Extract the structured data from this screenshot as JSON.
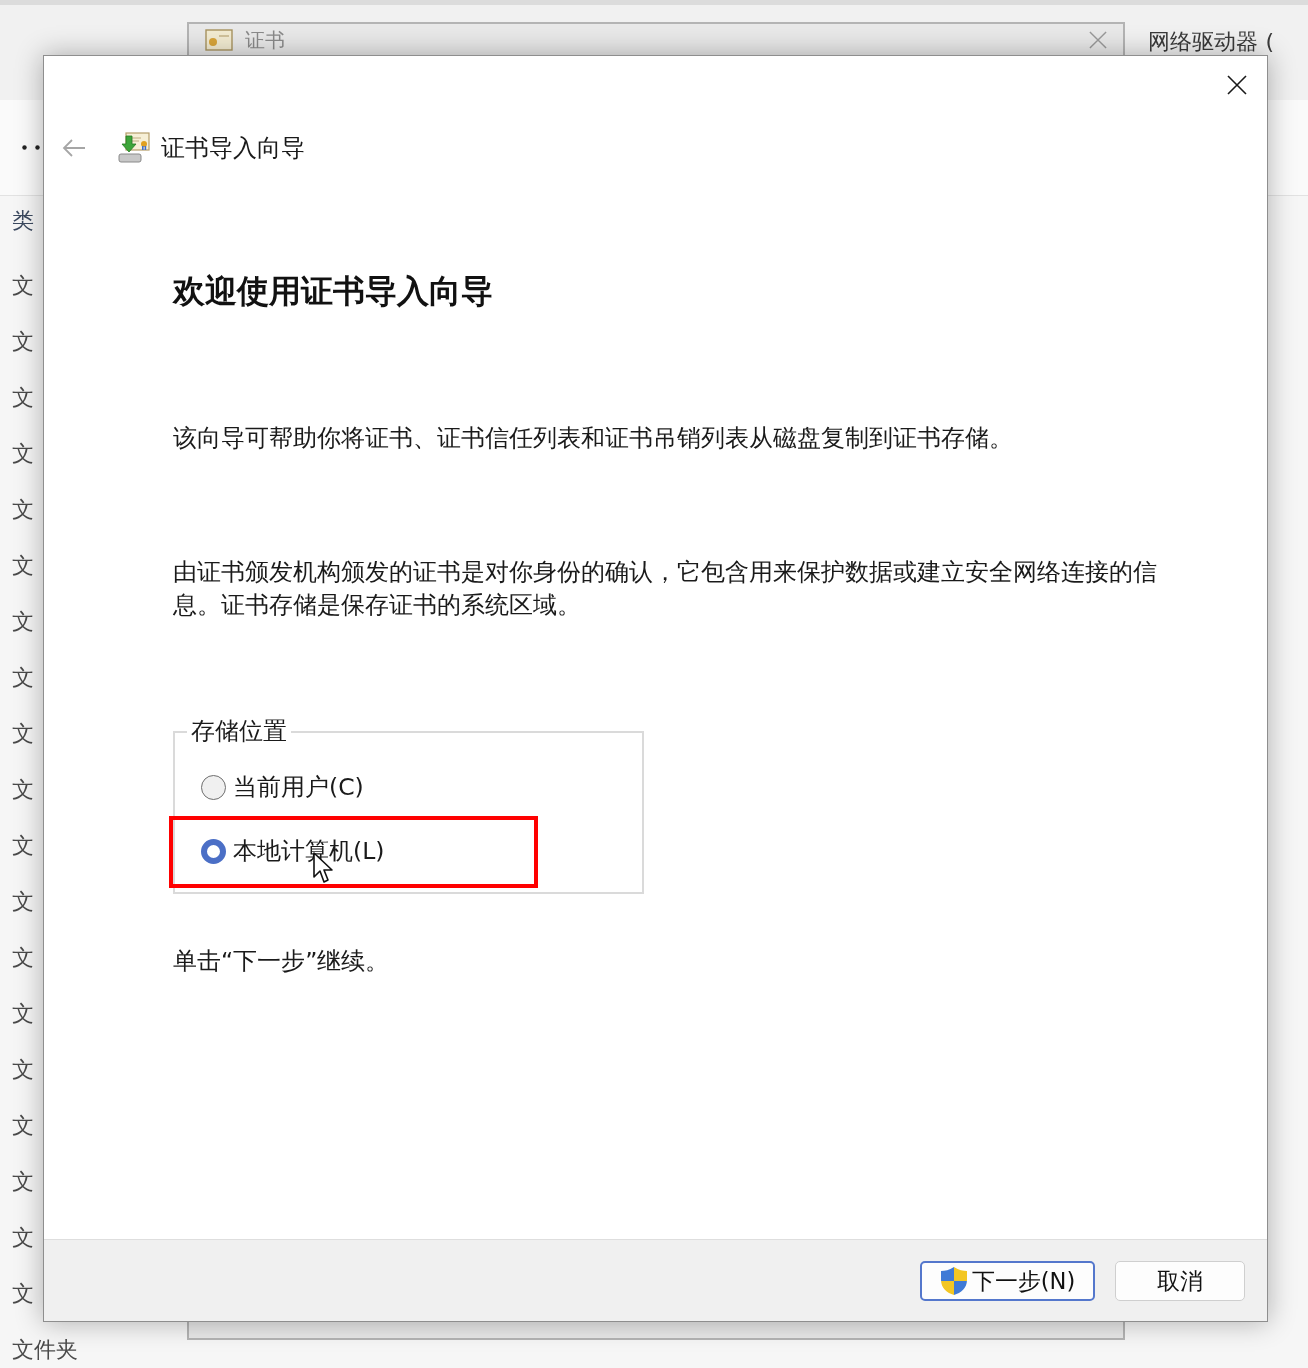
{
  "explorer": {
    "drive_label": "网络驱动器 (",
    "column_header": "类",
    "column_rows": [
      "文",
      "文",
      "文",
      "文",
      "文",
      "文",
      "文",
      "文",
      "文",
      "文",
      "文",
      "文",
      "文",
      "文",
      "文",
      "文",
      "文",
      "文",
      "文",
      "文件夹"
    ]
  },
  "background_window": {
    "title": "证书"
  },
  "wizard": {
    "back": {
      "disabled": true
    },
    "title": "证书导入向导",
    "heading": "欢迎使用证书导入向导",
    "paragraphs": [
      "该向导可帮助你将证书、证书信任列表和证书吊销列表从磁盘复制到证书存储。",
      "由证书颁发机构颁发的证书是对你身份的确认，它包含用来保护数据或建立安全网络连接的信息。证书存储是保存证书的系统区域。"
    ],
    "store_location": {
      "legend": "存储位置",
      "options": [
        {
          "label": "当前用户(C)",
          "selected": false,
          "highlighted": false
        },
        {
          "label": "本地计算机(L)",
          "selected": true,
          "highlighted": true
        }
      ]
    },
    "hint": "单击“下一步”继续。",
    "buttons": [
      {
        "label": "下一步(N)",
        "kind": "primary"
      },
      {
        "label": "取消",
        "kind": "secondary"
      }
    ]
  }
}
